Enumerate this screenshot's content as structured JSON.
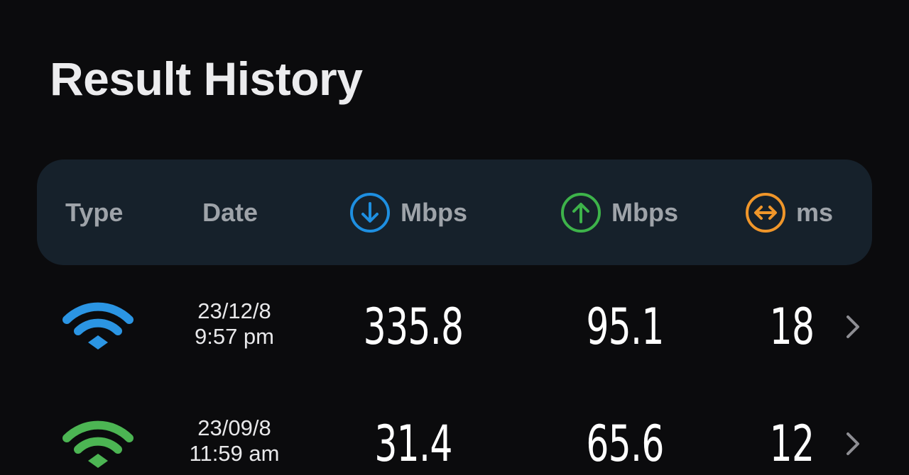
{
  "title": "Result History",
  "header": {
    "type_label": "Type",
    "date_label": "Date",
    "download_unit": "Mbps",
    "upload_unit": "Mbps",
    "ping_unit": "ms",
    "download_icon": "download-arrow-circle-icon",
    "upload_icon": "upload-arrow-circle-icon",
    "ping_icon": "ping-arrows-circle-icon"
  },
  "colors": {
    "background": "#0b0b0d",
    "header_bg": "#16212b",
    "download": "#1e8fe1",
    "upload": "#3db34a",
    "ping": "#f0962a",
    "wifi_row1": "#2b95e3",
    "wifi_row2": "#4cb553"
  },
  "rows": [
    {
      "type_icon": "wifi-icon",
      "date": "23/12/8",
      "time": "9:57 pm",
      "download": "335.8",
      "upload": "95.1",
      "ping": "18"
    },
    {
      "type_icon": "wifi-icon",
      "date": "23/09/8",
      "time": "11:59 am",
      "download": "31.4",
      "upload": "65.6",
      "ping": "12"
    }
  ]
}
